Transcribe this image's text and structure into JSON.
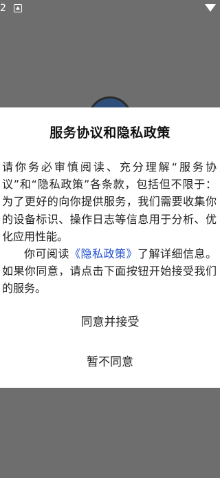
{
  "status_bar": {
    "time": "2"
  },
  "dialog": {
    "title": "服务协议和隐私政策",
    "paragraph1": "请你务必审慎阅读、充分理解“服务协议”和“隐私政策”各条款，包括但不限于：为了更好的向你提供服务，我们需要收集你的设备标识、操作日志等信息用于分析、优化应用性能。",
    "paragraph2_before": "你可阅读",
    "policy_link": "《隐私政策》",
    "paragraph2_after": "了解详细信息。如果你同意，请点击下面按钮开始接受我们的服务。",
    "agree_button": "同意并接受",
    "decline_button": "暂不同意"
  }
}
